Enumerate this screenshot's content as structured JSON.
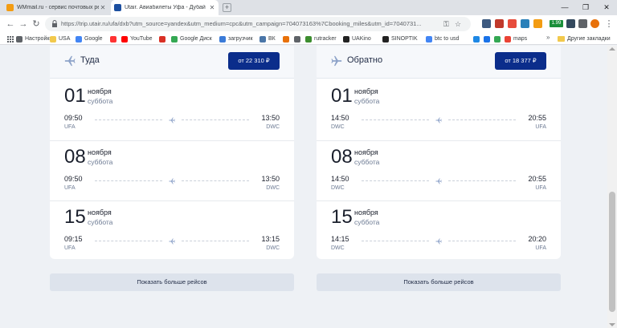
{
  "browser": {
    "tabs": [
      {
        "title": "WMmail.ru - сервис почтовых ре",
        "active": false,
        "favicon_color": "#f39c12"
      },
      {
        "title": "Utair. Авиабилеты Уфа - Дубай",
        "active": true,
        "favicon_color": "#1c4fa0"
      }
    ],
    "url": "https://trip.utair.ru/ufa/dxb?utm_source=yandex&utm_medium=cpc&utm_campaign=704073163%7Cbooking_miles&utm_id=7040731...",
    "extension_badge": "1.99",
    "bookmarks": [
      {
        "label": "Настройки",
        "icon": "gear-icon",
        "color": "#5f6368"
      },
      {
        "label": "USA",
        "icon": "folder-icon",
        "color": "#f2c94c"
      },
      {
        "label": "Google",
        "icon": "google-icon",
        "color": "#4285f4"
      },
      {
        "label": "",
        "icon": "yandex-icon",
        "color": "#ff3333"
      },
      {
        "label": "YouTube",
        "icon": "youtube-icon",
        "color": "#ff0000"
      },
      {
        "label": "",
        "icon": "gmail-icon",
        "color": "#d93025"
      },
      {
        "label": "Google Диск",
        "icon": "google-drive-icon",
        "color": "#34a853"
      },
      {
        "label": "загрузчик",
        "icon": "download-icon",
        "color": "#3b7bd8"
      },
      {
        "label": "ВК",
        "icon": "vk-icon",
        "color": "#4a76a8"
      },
      {
        "label": "",
        "icon": "bookmark-icon",
        "color": "#e8710a"
      },
      {
        "label": "",
        "icon": "bookmark-icon",
        "color": "#5f6368"
      },
      {
        "label": "rutracker",
        "icon": "rutracker-icon",
        "color": "#3c8d2f"
      },
      {
        "label": "UAKino",
        "icon": "uakino-icon",
        "color": "#222222"
      },
      {
        "label": "SINOPTIK",
        "icon": "sinoptik-icon",
        "color": "#222222"
      },
      {
        "label": "btc to usd",
        "icon": "google-icon",
        "color": "#4285f4"
      },
      {
        "label": "",
        "icon": "bookmark-icon",
        "color": "#1e88e5"
      },
      {
        "label": "",
        "icon": "bookmark-icon",
        "color": "#1a73e8"
      },
      {
        "label": "",
        "icon": "maps-icon",
        "color": "#34a853"
      },
      {
        "label": "maps",
        "icon": "maps-icon",
        "color": "#ea4335"
      }
    ],
    "bookmarks_more": "»",
    "other_bookmarks": "Другие закладки"
  },
  "outbound": {
    "label": "Туда",
    "price": "от 22 310 ₽",
    "flights": [
      {
        "day": "01",
        "month": "ноября",
        "weekday": "суббота",
        "dep_time": "09:50",
        "arr_time": "13:50",
        "dep_code": "UFA",
        "arr_code": "DWC"
      },
      {
        "day": "08",
        "month": "ноября",
        "weekday": "суббота",
        "dep_time": "09:50",
        "arr_time": "13:50",
        "dep_code": "UFA",
        "arr_code": "DWC"
      },
      {
        "day": "15",
        "month": "ноября",
        "weekday": "суббота",
        "dep_time": "09:15",
        "arr_time": "13:15",
        "dep_code": "UFA",
        "arr_code": "DWC"
      }
    ],
    "more_label": "Показать больше рейсов"
  },
  "return": {
    "label": "Обратно",
    "price": "от 18 377 ₽",
    "flights": [
      {
        "day": "01",
        "month": "ноября",
        "weekday": "суббота",
        "dep_time": "14:50",
        "arr_time": "20:55",
        "dep_code": "DWC",
        "arr_code": "UFA"
      },
      {
        "day": "08",
        "month": "ноября",
        "weekday": "суббота",
        "dep_time": "14:50",
        "arr_time": "20:55",
        "dep_code": "DWC",
        "arr_code": "UFA"
      },
      {
        "day": "15",
        "month": "ноября",
        "weekday": "суббота",
        "dep_time": "14:15",
        "arr_time": "20:20",
        "dep_code": "DWC",
        "arr_code": "UFA"
      }
    ],
    "more_label": "Показать больше рейсов"
  }
}
